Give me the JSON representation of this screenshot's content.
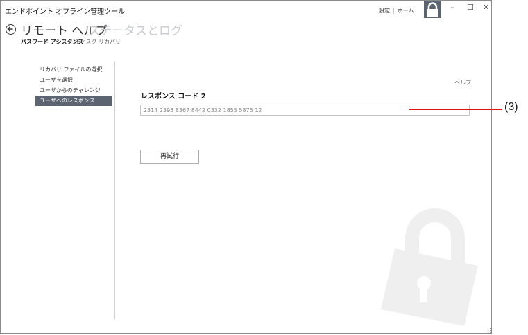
{
  "window": {
    "app_title": "エンドポイント オフライン管理ツール",
    "nav": {
      "settings": "設定",
      "home": "ホーム"
    },
    "controls": {
      "minimize": "–",
      "maximize": "☐",
      "close": "✕"
    }
  },
  "header": {
    "active_title": "リモート ヘルプ",
    "inactive_title": "ステータスとログ",
    "tabs": [
      {
        "label": "パスワード アシスタンス",
        "active": true
      },
      {
        "label": "ディスク リカバリ",
        "active": false
      }
    ]
  },
  "sidebar": {
    "steps": [
      {
        "label": "リカバリ ファイルの選択",
        "active": false
      },
      {
        "label": "ユーザを選択",
        "active": false
      },
      {
        "label": "ユーザからのチャレンジ",
        "active": false
      },
      {
        "label": "ユーザへのレスポンス",
        "active": true
      }
    ]
  },
  "main": {
    "help": "ヘルプ",
    "field_label": "レスポンス コード 2",
    "response_value": "2314 2395 8367 8442 0332 1855 5875 12",
    "retry_button": "再試行"
  },
  "annotation": {
    "label": "(3)",
    "color": "#e01010"
  },
  "colors": {
    "accent": "#5b6470",
    "inactive_text": "#c8ccd0",
    "watermark": "#eeeeee"
  },
  "icons": {
    "back": "back-arrow-icon",
    "lock_tile": "lock-icon",
    "watermark": "lock-watermark-icon",
    "resize": "resize-grip-icon"
  }
}
